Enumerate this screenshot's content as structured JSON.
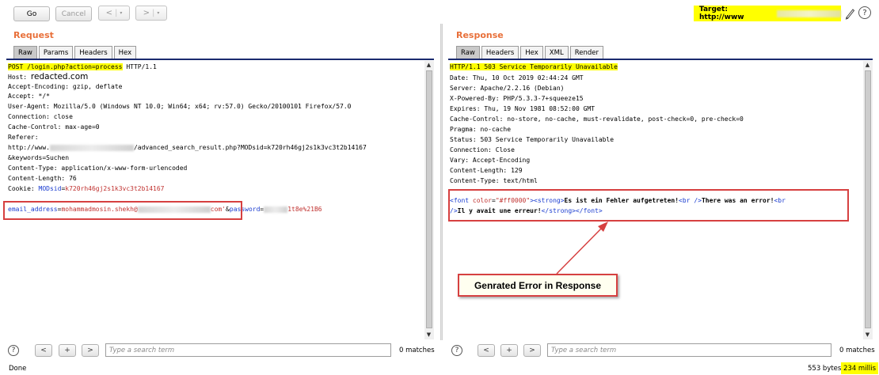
{
  "toolbar": {
    "go_label": "Go",
    "cancel_label": "Cancel",
    "back_symbol": "<",
    "forward_symbol": ">",
    "dropdown_symbol": "▾",
    "target_label": "Target: http://www",
    "help_symbol": "?"
  },
  "request": {
    "title": "Request",
    "tabs": [
      "Raw",
      "Params",
      "Headers",
      "Hex"
    ],
    "active_tab": "Raw",
    "line_method": "POST /login.php?action=process",
    "line_proto": " HTTP/1.1",
    "host_label": "Host:",
    "host_value": "redacted.com",
    "accept_encoding": "Accept-Encoding: gzip, deflate",
    "accept": "Accept: */*",
    "user_agent": "User-Agent: Mozilla/5.0 (Windows NT 10.0; Win64; x64; rv:57.0) Gecko/20100101 Firefox/57.0",
    "connection": "Connection: close",
    "cache_control": "Cache-Control: max-age=0",
    "referer_label": "Referer:",
    "referer_prefix": "http://www.",
    "referer_suffix": "/advanced_search_result.php?MODsid=k720rh46gj2s1k3vc3t2b14167",
    "keywords": "&keywords=Suchen",
    "content_type": "Content-Type: application/x-www-form-urlencoded",
    "content_length": "Content-Length: 76",
    "cookie_label": "Cookie: ",
    "cookie_key": "MODsid",
    "cookie_value": "k720rh46gj2s1k3vc3t2b14167",
    "body_key1": "email_address",
    "body_val1_start": "mohammadmosin.shekh@",
    "body_val1_end": "com'",
    "body_amp": "&",
    "body_key2": "password",
    "body_val2_end": "1t8e%21B6",
    "eq": "="
  },
  "response": {
    "title": "Response",
    "tabs": [
      "Raw",
      "Headers",
      "Hex",
      "XML",
      "Render"
    ],
    "active_tab": "Raw",
    "status_line": "HTTP/1.1 503 Service Temporarily Unavailable",
    "headers": [
      "Date: Thu, 10 Oct 2019 02:44:24 GMT",
      "Server: Apache/2.2.16 (Debian)",
      "X-Powered-By: PHP/5.3.3-7+squeeze15",
      "Expires: Thu, 19 Nov 1981 08:52:00 GMT",
      "Cache-Control: no-store, no-cache, must-revalidate, post-check=0, pre-check=0",
      "Pragma: no-cache",
      "Status: 503 Service Temporarily Unavailable",
      "Connection: Close",
      "Vary: Accept-Encoding",
      "Content-Length: 129",
      "Content-Type: text/html"
    ],
    "body_font_open": "<font ",
    "body_color_attr": "color",
    "body_eq": "=",
    "body_color_val": "\"#ff0000\"",
    "body_gt": ">",
    "body_strong_open": "<strong>",
    "body_text1": "Es ist ein Fehler aufgetreten!",
    "body_br1": "<br />",
    "body_text2": "There was an error!",
    "body_br2a": "<br",
    "body_br2b": "/>",
    "body_text3": "Il y avait une erreur!",
    "body_close": "</strong></font>"
  },
  "search": {
    "placeholder": "Type a search term",
    "prev": "<",
    "add": "+",
    "next": ">",
    "help": "?",
    "left_matches": "0 matches",
    "right_matches": "0 matches"
  },
  "status": {
    "left": "Done",
    "bytes": "553 bytes |",
    "millis": "234 millis"
  },
  "annotation": {
    "callout": "Genrated Error in Response"
  }
}
